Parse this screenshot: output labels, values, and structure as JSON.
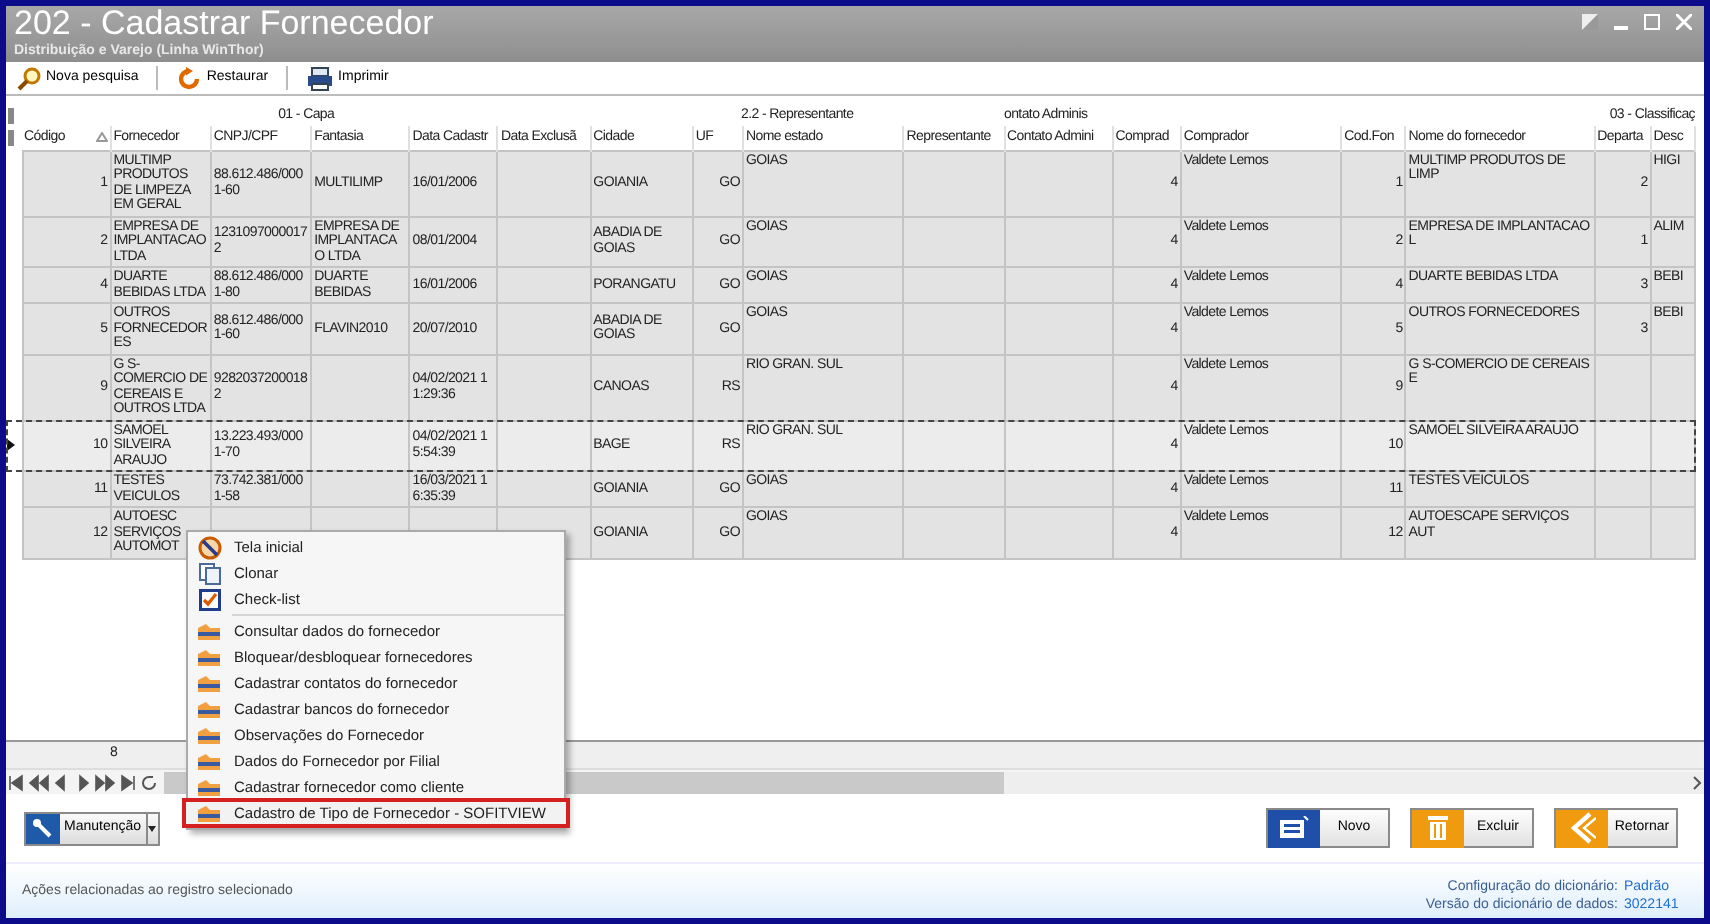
{
  "window": {
    "title": "202 - Cadastrar  Fornecedor",
    "subtitle": "Distribuição e Varejo (Linha WinThor)"
  },
  "toolbar": [
    {
      "label": "Nova pesquisa",
      "kind": "search"
    },
    {
      "label": "Restaurar",
      "kind": "restore"
    },
    {
      "label": "Imprimir",
      "kind": "print"
    }
  ],
  "table": {
    "groups": [
      "01 - Capa",
      "2.2 - Representante",
      "ontato Adminis",
      "03 - Classificaç"
    ],
    "columns": [
      {
        "label": "Código",
        "sorted": true
      },
      {
        "label": "Fornecedor",
        "sorted": false
      },
      {
        "label": "CNPJ/CPF",
        "sorted": false
      },
      {
        "label": "Fantasia",
        "sorted": false
      },
      {
        "label": "Data Cadastr",
        "sorted": false
      },
      {
        "label": "Data Exclusã",
        "sorted": false
      },
      {
        "label": "Cidade",
        "sorted": false
      },
      {
        "label": "UF",
        "sorted": false
      },
      {
        "label": "Nome estado",
        "sorted": false
      },
      {
        "label": "Representante",
        "sorted": false
      },
      {
        "label": "Contato Admini",
        "sorted": false
      },
      {
        "label": "Comprad",
        "sorted": false
      },
      {
        "label": "Comprador",
        "sorted": false
      },
      {
        "label": "Cod.Fon",
        "sorted": false
      },
      {
        "label": "Nome do fornecedor",
        "sorted": false
      },
      {
        "label": "Departa",
        "sorted": false
      },
      {
        "label": "Desc",
        "sorted": false
      }
    ],
    "rows": [
      {
        "selected": false,
        "cells": [
          "1",
          "MULTIMP PRODUTOS DE LIMPEZA EM GERAL",
          "88.612.486/0001-60",
          "MULTILIMP",
          "16/01/2006",
          null,
          "GOIANIA",
          "GO",
          "GOIAS",
          null,
          null,
          "4",
          "Valdete Lemos",
          "1",
          "MULTIMP PRODUTOS DE LIMP",
          "2",
          "HIGI"
        ]
      },
      {
        "selected": false,
        "cells": [
          "2",
          "EMPRESA DE IMPLANTACAO LTDA",
          "12310970000172",
          "EMPRESA DE IMPLANTACAO LTDA",
          "08/01/2004",
          null,
          "ABADIA DE GOIAS",
          "GO",
          "GOIAS",
          null,
          null,
          "4",
          "Valdete Lemos",
          "2",
          "EMPRESA DE IMPLANTACAO L",
          "1",
          "ALIM"
        ]
      },
      {
        "selected": false,
        "cells": [
          "4",
          "DUARTE BEBIDAS LTDA",
          "88.612.486/0001-80",
          "DUARTE BEBIDAS",
          "16/01/2006",
          null,
          "PORANGATU",
          "GO",
          "GOIAS",
          null,
          null,
          "4",
          "Valdete Lemos",
          "4",
          "DUARTE BEBIDAS LTDA",
          "3",
          "BEBI"
        ]
      },
      {
        "selected": false,
        "cells": [
          "5",
          "OUTROS FORNECEDORES",
          "88.612.486/0001-60",
          "FLAVIN2010",
          "20/07/2010",
          null,
          "ABADIA DE GOIAS",
          "GO",
          "GOIAS",
          null,
          null,
          "4",
          "Valdete Lemos",
          "5",
          "OUTROS FORNECEDORES",
          "3",
          "BEBI"
        ]
      },
      {
        "selected": false,
        "cells": [
          "9",
          "G S-COMERCIO DE CEREAIS E OUTROS LTDA",
          "92820372000182",
          null,
          "04/02/2021 11:29:36",
          null,
          "CANOAS",
          "RS",
          "RIO GRAN. SUL",
          null,
          null,
          "4",
          "Valdete Lemos",
          "9",
          "G S-COMERCIO DE CEREAIS E",
          null,
          null
        ]
      },
      {
        "selected": true,
        "cells": [
          "10",
          "SAMOEL SILVEIRA ARAUJO",
          "13.223.493/0001-70",
          null,
          "04/02/2021 15:54:39",
          null,
          "BAGE",
          "RS",
          "RIO GRAN. SUL",
          null,
          null,
          "4",
          "Valdete Lemos",
          "10",
          "SAMOEL SILVEIRA ARAUJO",
          null,
          null
        ]
      },
      {
        "selected": false,
        "cells": [
          "11",
          "TESTES VEICULOS",
          "73.742.381/0001-58",
          null,
          "16/03/2021 16:35:39",
          null,
          "GOIANIA",
          "GO",
          "GOIAS",
          null,
          null,
          "4",
          "Valdete Lemos",
          "11",
          "TESTES VEICULOS",
          null,
          null
        ]
      },
      {
        "selected": false,
        "cells": [
          "12",
          "AUTOESC SERVIÇOS AUTOMOT",
          null,
          null,
          null,
          null,
          "GOIANIA",
          "GO",
          "GOIAS",
          null,
          null,
          "4",
          "Valdete Lemos",
          "12",
          "AUTOESCAPE SERVIÇOS AUT",
          null,
          null
        ]
      }
    ],
    "footer_count": "8"
  },
  "context_menu": {
    "sections": [
      {
        "items": [
          {
            "label": "Tela inicial",
            "kind": "home",
            "highlighted": false
          },
          {
            "label": "Clonar",
            "kind": "copy",
            "highlighted": false
          },
          {
            "label": "Check-list",
            "kind": "checklist",
            "highlighted": false
          }
        ]
      },
      {
        "items": [
          {
            "label": "Consultar dados do fornecedor",
            "kind": "action",
            "highlighted": false
          },
          {
            "label": "Bloquear/desbloquear fornecedores",
            "kind": "action",
            "highlighted": false
          },
          {
            "label": "Cadastrar contatos do fornecedor",
            "kind": "action",
            "highlighted": false
          },
          {
            "label": "Cadastrar bancos do fornecedor",
            "kind": "action",
            "highlighted": false
          },
          {
            "label": "Observações do Fornecedor",
            "kind": "action",
            "highlighted": false
          },
          {
            "label": "Dados do Fornecedor por Filial",
            "kind": "action",
            "highlighted": false
          },
          {
            "label": "Cadastrar fornecedor como cliente",
            "kind": "action",
            "highlighted": false
          },
          {
            "label": "Cadastro de Tipo de Fornecedor - SOFITVIEW",
            "kind": "action",
            "highlighted": true
          }
        ]
      }
    ]
  },
  "maintenance_button": {
    "label": "Manutenção"
  },
  "buttons": [
    {
      "label": "Novo",
      "kind": "new"
    },
    {
      "label": "Excluir",
      "kind": "delete"
    },
    {
      "label": "Retornar",
      "kind": "back"
    }
  ],
  "status_bar": {
    "message": "Ações relacionadas ao registro selecionado",
    "info": [
      {
        "label": "Configuração do dicionário:",
        "value": "Padrão"
      },
      {
        "label": "Versão do dicionário de dados:",
        "value": "3022141"
      }
    ]
  }
}
